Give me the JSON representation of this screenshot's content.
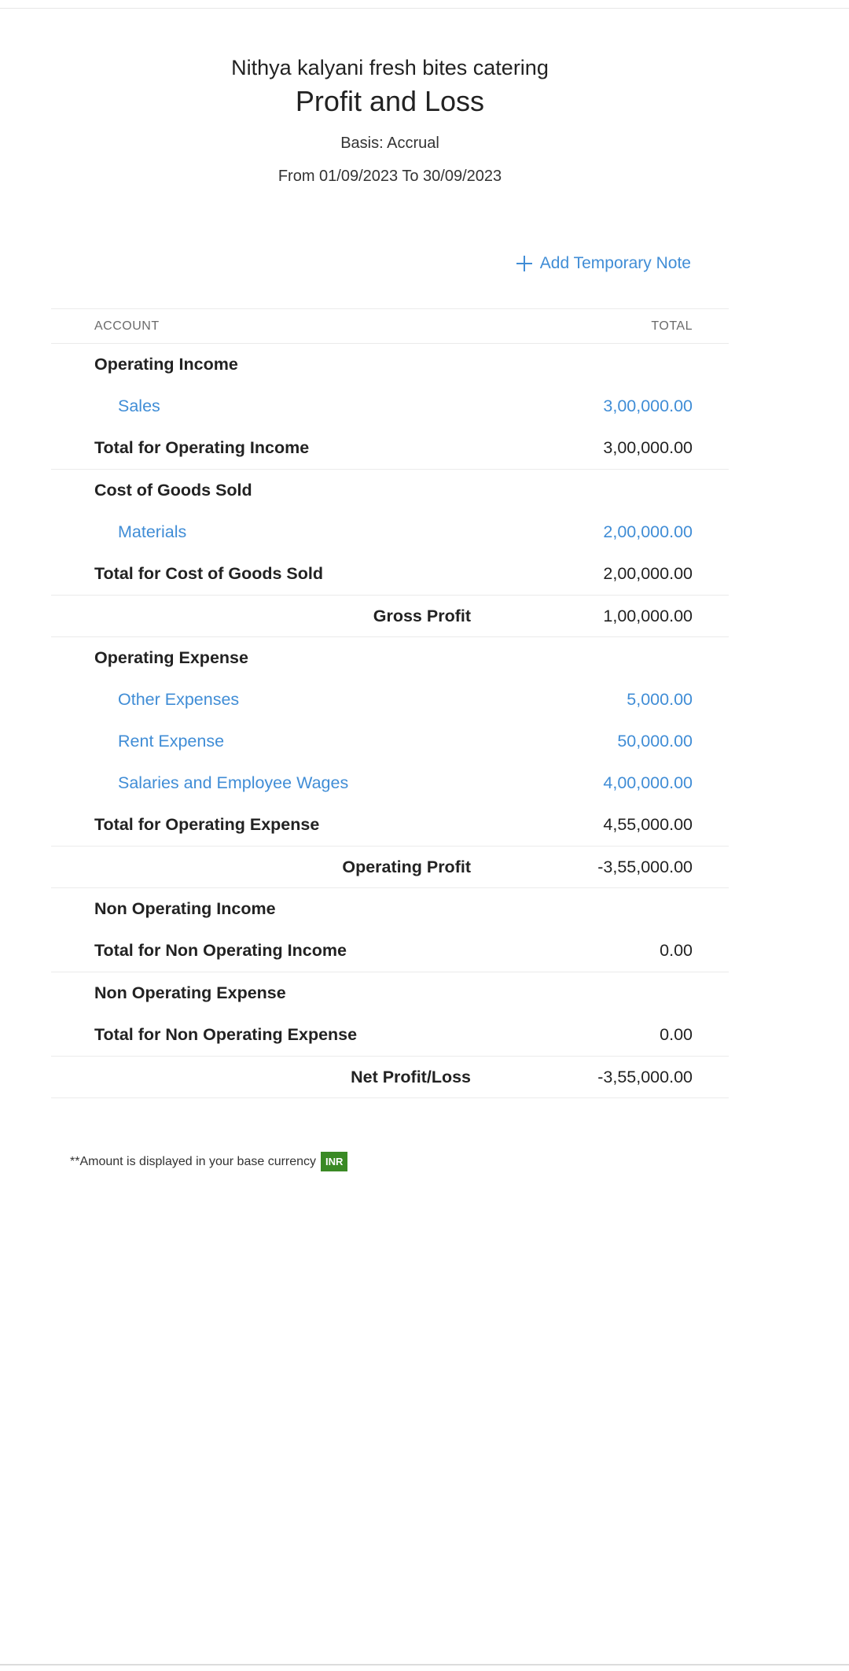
{
  "header": {
    "org_name": "Nithya kalyani fresh bites catering",
    "title": "Profit and Loss",
    "basis": "Basis: Accrual",
    "period": "From 01/09/2023 To 30/09/2023"
  },
  "actions": {
    "add_note_label": "Add Temporary Note",
    "add_note_icon": "plus-icon"
  },
  "table": {
    "col_account": "ACCOUNT",
    "col_total": "TOTAL",
    "operating_income": {
      "heading": "Operating Income",
      "accounts": [
        {
          "name": "Sales",
          "amount": "3,00,000.00"
        }
      ],
      "total_label": "Total for Operating Income",
      "total_amount": "3,00,000.00"
    },
    "cogs": {
      "heading": "Cost of Goods Sold",
      "accounts": [
        {
          "name": "Materials",
          "amount": "2,00,000.00"
        }
      ],
      "total_label": "Total for Cost of Goods Sold",
      "total_amount": "2,00,000.00"
    },
    "gross_profit": {
      "label": "Gross Profit",
      "amount": "1,00,000.00"
    },
    "operating_expense": {
      "heading": "Operating Expense",
      "accounts": [
        {
          "name": "Other Expenses",
          "amount": "5,000.00"
        },
        {
          "name": "Rent Expense",
          "amount": "50,000.00"
        },
        {
          "name": "Salaries and Employee Wages",
          "amount": "4,00,000.00"
        }
      ],
      "total_label": "Total for Operating Expense",
      "total_amount": "4,55,000.00"
    },
    "operating_profit": {
      "label": "Operating Profit",
      "amount": "-3,55,000.00"
    },
    "non_operating_income": {
      "heading": "Non Operating Income",
      "total_label": "Total for Non Operating Income",
      "total_amount": "0.00"
    },
    "non_operating_expense": {
      "heading": "Non Operating Expense",
      "total_label": "Total for Non Operating Expense",
      "total_amount": "0.00"
    },
    "net_profit": {
      "label": "Net Profit/Loss",
      "amount": "-3,55,000.00"
    }
  },
  "footer": {
    "note": "**Amount is displayed in your base currency",
    "currency": "INR"
  },
  "colors": {
    "link": "#408dd6",
    "badge": "#3a8a25"
  }
}
